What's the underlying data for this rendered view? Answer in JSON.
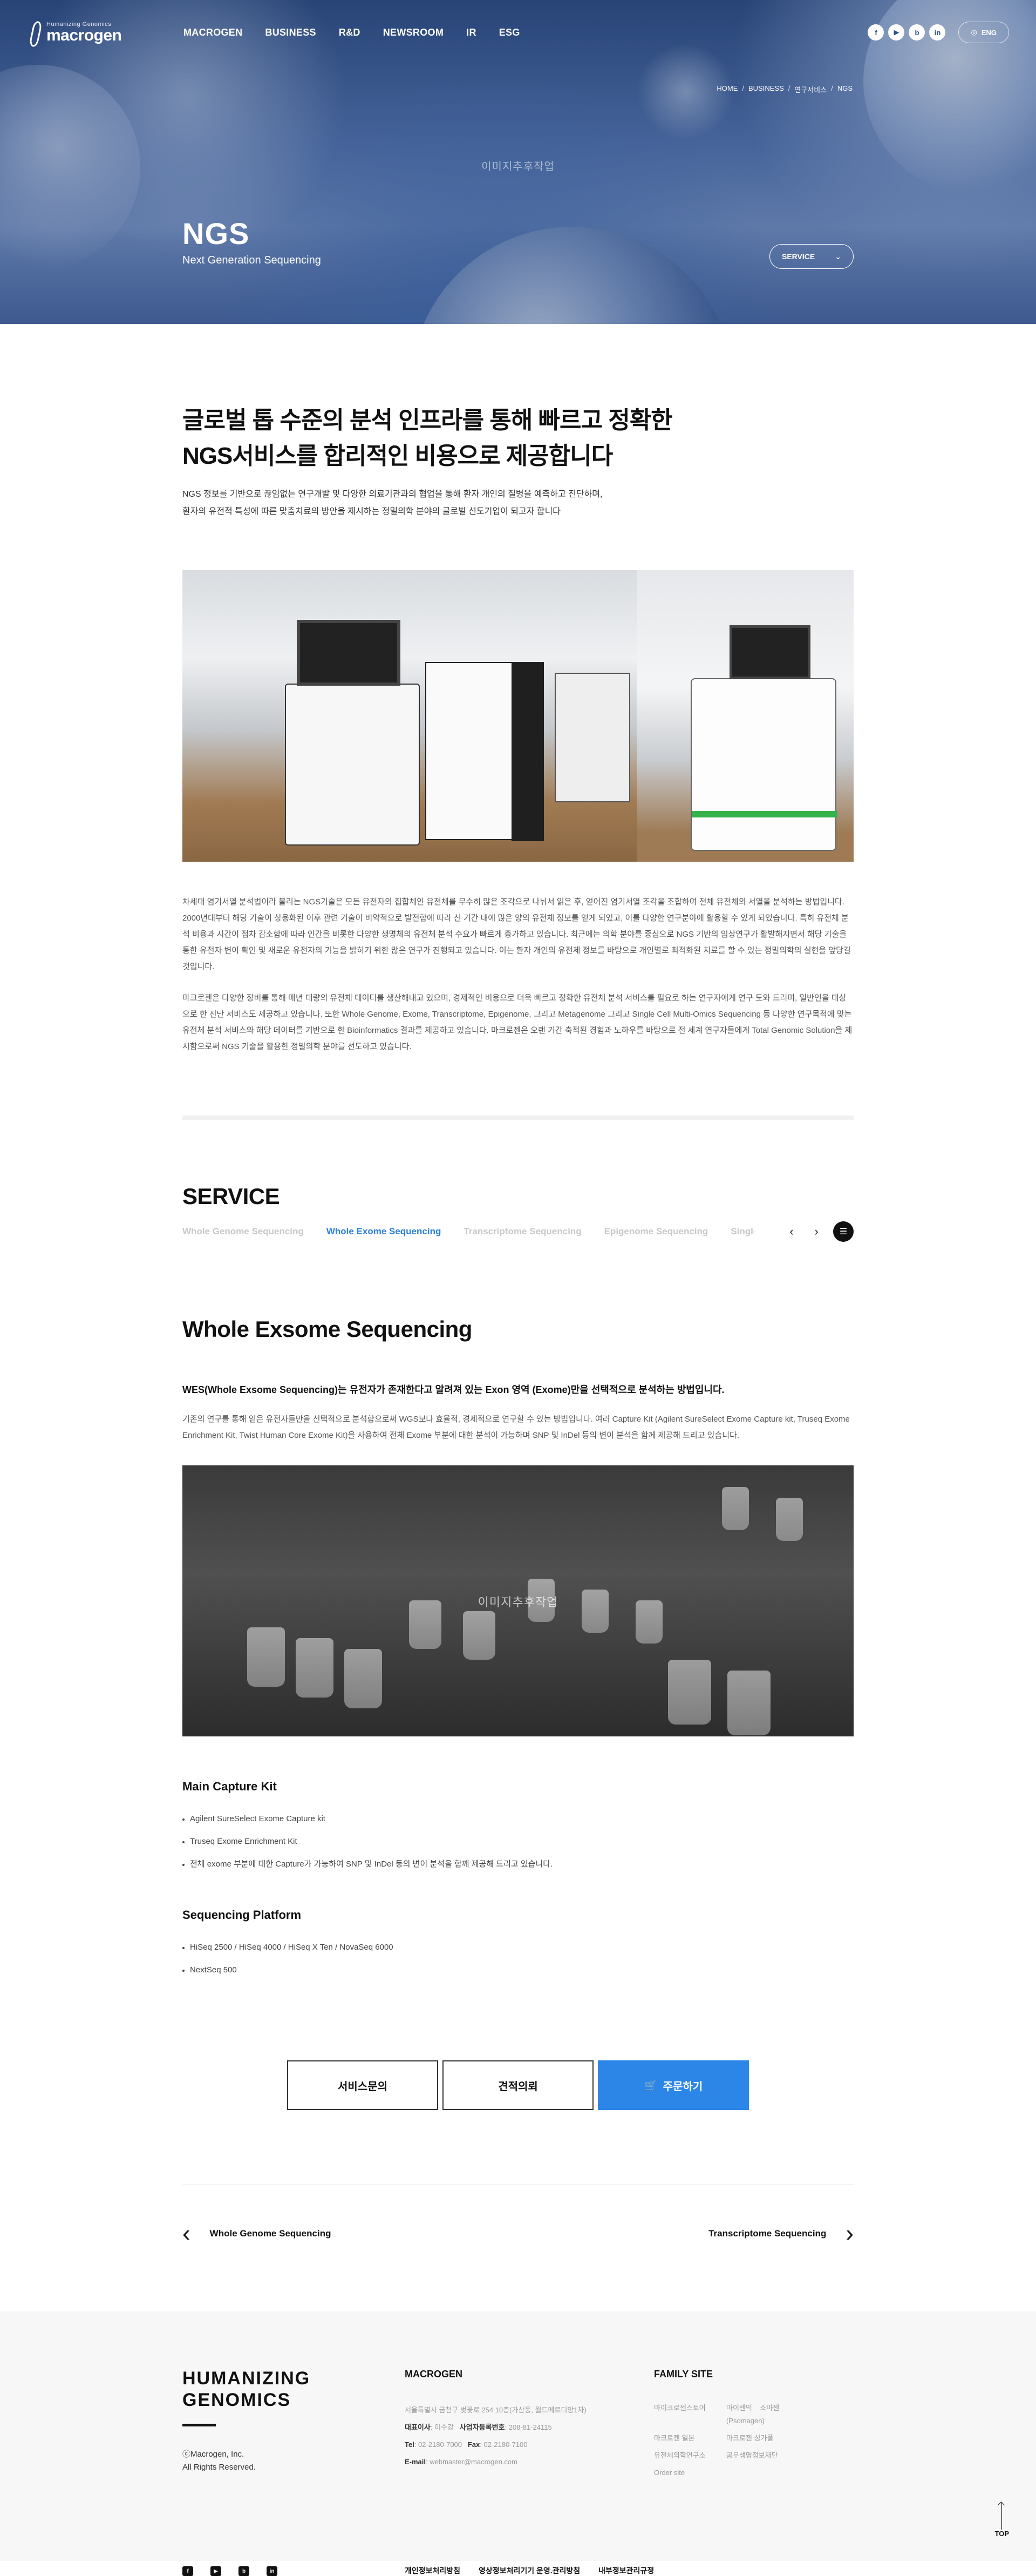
{
  "header": {
    "logo_sub": "Humanizing Genomics",
    "logo_main": "macrogen",
    "menu": [
      "MACROGEN",
      "BUSINESS",
      "R&D",
      "NEWSROOM",
      "IR",
      "ESG"
    ],
    "sns": [
      {
        "icon": "facebook-icon",
        "glyph": "f"
      },
      {
        "icon": "youtube-icon",
        "glyph": "▶"
      },
      {
        "icon": "blog-icon",
        "glyph": "b"
      },
      {
        "icon": "linkedin-icon",
        "glyph": "in"
      }
    ],
    "lang": "ENG"
  },
  "hero": {
    "breadcrumb": [
      "HOME",
      "BUSINESS",
      "연구서비스",
      "NGS"
    ],
    "watermark": "이미지추후작업",
    "title": "NGS",
    "subtitle": "Next Generation Sequencing",
    "select_label": "SERVICE"
  },
  "intro": {
    "heading_line1": "글로벌 톱 수준의 분석 인프라를 통해 빠르고 정확한",
    "heading_line2": "NGS서비스를 합리적인 비용으로 제공합니다",
    "lead_line1": "NGS 정보를 기반으로 끊임없는 연구개발 및 다양한 의료기관과의 협업을 통해 환자 개인의 질병을 예측하고 진단하며,",
    "lead_line2": "환자의 유전적 특성에 따른 맞춤치료의 방안을 제시하는 정밀의학 분야의 글로벌 선도기업이 되고자 합니다",
    "desc1": "차세대 염기서열 분석법이라 불리는 NGS기술은 모든 유전자의 집합체인 유전체를 무수히 많은 조각으로 나눠서 읽은 후, 얻어진 염기서열 조각을 조합하여 전체 유전체의 서열을 분석하는 방법입니다. 2000년대부터 해당 기술이 상용화된 이후 관련 기술이 비약적으로 발전함에 따라 신 기간 내에 많은 양의 유전체 정보를 얻게 되었고, 이를 다양한 연구분야에 활용할 수 있게 되었습니다. 특히 유전체 분석 비용과 시간이 점차 감소함에 따라 인간을 비롯한 다양한 생명체의 유전체 분석 수요가 빠르게 증가하고 있습니다. 최근에는 의학 분야를 중심으로 NGS 기반의 임상연구가 활발해지면서 해당 기술을 통한 유전자 변이 확인 및 새로운 유전자의 기능을 밝히기 위한 많은 연구가 진행되고 있습니다. 이는 환자 개인의 유전체 정보를 바탕으로 개인별로 최적화된 치료를 할 수 있는 정밀의학의 실현을 앞당길 것입니다.",
    "desc2": "마크로젠은 다양한 장비를 통해 매년 대량의 유전체 데이터를 생산해내고 있으며, 경제적인 비용으로 더욱 빠르고 정확한 유전체 분석 서비스를 필요로 하는 연구자에게 연구 도와 드리며, 일반인을 대상으로 한 진단 서비스도 제공하고 있습니다. 또한 Whole Genome, Exome, Transcriptome, Epigenome, 그리고 Metagenome 그리고 Single Cell Multi-Omics Sequencing 등 다양한 연구목적에 맞는 유전체 분석 서비스와 해당 데이터를 기반으로 한 Bioinformatics 결과를 제공하고 있습니다. 마크로젠은 오랜 기간 축적된 경험과 노하우를 바탕으로 전 세계 연구자들에게 Total Genomic Solution을 제시함으로써 NGS 기술을 활용한 정밀의학 분야를 선도하고 있습니다."
  },
  "service": {
    "heading": "SERVICE",
    "tabs": [
      "Whole Genome Sequencing",
      "Whole Exome Sequencing",
      "Transcriptome Sequencing",
      "Epigenome Sequencing",
      "Single Cell Sequencing"
    ],
    "active_tab": 1,
    "title": "Whole Exsome Sequencing",
    "sub": "WES(Whole Exsome Sequencing)는 유전자가 존재한다고 알려져 있는 Exon 영역 (Exome)만을 선택적으로 분석하는 방법입니다.",
    "text": "기존의 연구를 통해 얻은 유전자들만을 선택적으로 분석함으로써 WGS보다 효율적, 경제적으로 연구할 수 있는 방법입니다. 여러 Capture Kit (Agilent SureSelect Exome Capture kit, Truseq Exome Enrichment Kit, Twist Human Core Exome Kit)을 사용하여 전체 Exome 부분에 대한 분석이 가능하며 SNP 및 InDel 등의 변이 분석을 함께 제공해 드리고 있습니다.",
    "image_watermark": "이미지추후작업",
    "kit_title": "Main Capture Kit",
    "kits": [
      "Agilent SureSelect Exome Capture kit",
      "Truseq Exome Enrichment Kit",
      "전체 exome 부분에 대한 Capture가 가능하여 SNP 및 InDel 등의 변이 분석을 함께 제공해 드리고 있습니다."
    ],
    "platform_title": "Sequencing Platform",
    "platforms": [
      "HiSeq 2500 / HiSeq 4000 / HiSeq X Ten / NovaSeq 6000",
      "NextSeq 500"
    ]
  },
  "actions": {
    "inquiry": "서비스문의",
    "quote": "견적의뢰",
    "order": "주문하기",
    "accent": "#2b86e8"
  },
  "pager": {
    "prev": "Whole Genome Sequencing",
    "next": "Transcriptome Sequencing"
  },
  "footer": {
    "brand_line1": "HUMANIZING",
    "brand_line2": "GENOMICS",
    "copy_line1": "ⓒMacrogen, Inc.",
    "copy_line2": "All Rights Reserved.",
    "macrogen_title": "MACROGEN",
    "address": "서울특별시 금천구 벚꽃로 254 10층(가산동, 월드메르디앙1차)",
    "ceo_label": "대표이사",
    "ceo": ": 이수강",
    "biz_label": "사업자등록번호",
    "biz": ": 208-81-24115",
    "tel_label": "Tel",
    "tel": ": 02-2180-7000",
    "fax_label": "Fax",
    "fax": ": 02-2180-7100",
    "email_label": "E-mail",
    "email": ": webmaster@macrogen.com",
    "family_title": "FAMILY SITE",
    "family": [
      "마이크로젠스토어",
      "마이젠믹",
      "소마젠(Psomagen)",
      "마크로젠 일본",
      "마크로젠 싱가폴",
      "",
      "유전체의학연구소",
      "공무생명정보재단",
      "",
      "Order site"
    ],
    "links": [
      "개인정보처리방침",
      "영상정보처리기기 운영.관리방침",
      "내부정보관리규정"
    ],
    "top": "TOP"
  }
}
